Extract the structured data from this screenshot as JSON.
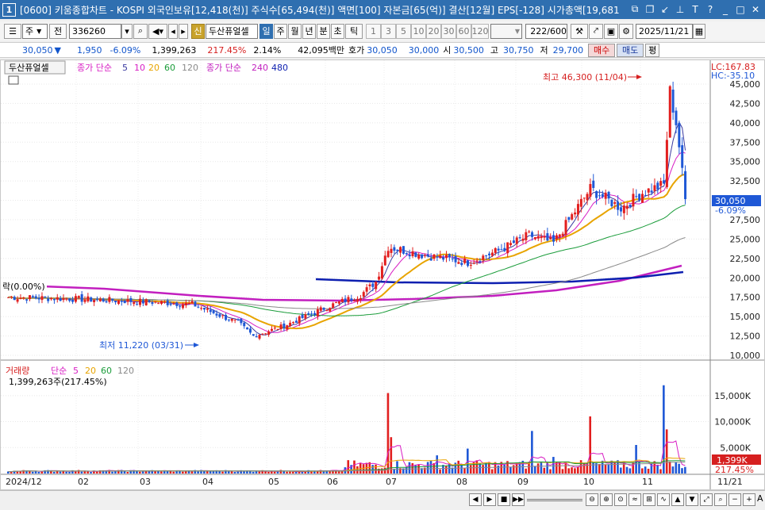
{
  "window": {
    "number": "1",
    "title": "[0600] 키움종합차트 - KOSPI 외국인보유[12,418(천)] 주식수[65,494(천)] 액면[100] 자본금[65(억)] 결산[12월] EPS[-128] 시가총액[19,681"
  },
  "toolbar": {
    "type_sel": "주",
    "prev_label": "전",
    "code": "336260",
    "shin_label": "신",
    "stock_name": "두산퓨얼셀",
    "periods": [
      "일",
      "주",
      "월",
      "년",
      "분",
      "초",
      "틱"
    ],
    "minutes": [
      "1",
      "3",
      "5",
      "10",
      "20",
      "30",
      "60",
      "120"
    ],
    "count": "222",
    "total": "/600",
    "date": "2025/11/21"
  },
  "quote": {
    "price": "30,050",
    "arrow": "▼",
    "change": "1,950",
    "change_pct": "-6.09%",
    "volume": "1,399,263",
    "vol_ratio": "217.45%",
    "turnover": "2.14%",
    "amount": "42,095백만",
    "hoga_label": "호가",
    "bid": "30,050",
    "ask": "30,000",
    "open_label": "시",
    "open": "30,500",
    "high_label": "고",
    "high": "30,750",
    "low_label": "저",
    "low": "29,700",
    "buy": "매수",
    "sell": "매도",
    "eval": "평"
  },
  "chart": {
    "legend_name": "두산퓨얼셀",
    "legend_ma_label": "종가 단순",
    "ma_periods": [
      "5",
      "10",
      "20",
      "60",
      "120"
    ],
    "legend_long_label": "종가 단순",
    "long_periods": [
      "240",
      "480"
    ],
    "lc": "LC:167.83",
    "hc": "HC:-35.10",
    "ytick_labels": [
      "45,000",
      "42,500",
      "40,000",
      "37,500",
      "35,000",
      "32,500",
      "30,000",
      "27,500",
      "25,000",
      "22,500",
      "20,000",
      "17,500",
      "15,000",
      "12,500",
      "10,000"
    ],
    "current_tag": "30,050",
    "current_pct": "-6.09%",
    "high_annot": "최고 46,300 (11/04)",
    "low_annot": "최저 11,220 (03/31)",
    "left_tag": "락(0.00%)",
    "vol_legend_label": "거래량",
    "vol_legend_ma": "단순",
    "vol_ma_periods": [
      "5",
      "20",
      "60",
      "120"
    ],
    "vol_info": "1,399,263주(217.45%)",
    "vol_ticks": [
      "15,000K",
      "10,000K",
      "5,000K"
    ],
    "vol_tag": "1,399K",
    "vol_pct": "217.45%",
    "x_labels": [
      "2024/12",
      "02",
      "03",
      "04",
      "05",
      "06",
      "07",
      "08",
      "09",
      "10",
      "11",
      "11/21"
    ]
  },
  "colors": {
    "up": "#e21f1f",
    "down": "#1f58d6",
    "ma5": "#3a3aa0",
    "ma10": "#d81fc4",
    "ma20": "#e8a400",
    "ma60": "#1a9c3a",
    "ma120": "#8a8a8a",
    "ma240": "#c21fbf",
    "ma480": "#0d1fb0"
  }
}
